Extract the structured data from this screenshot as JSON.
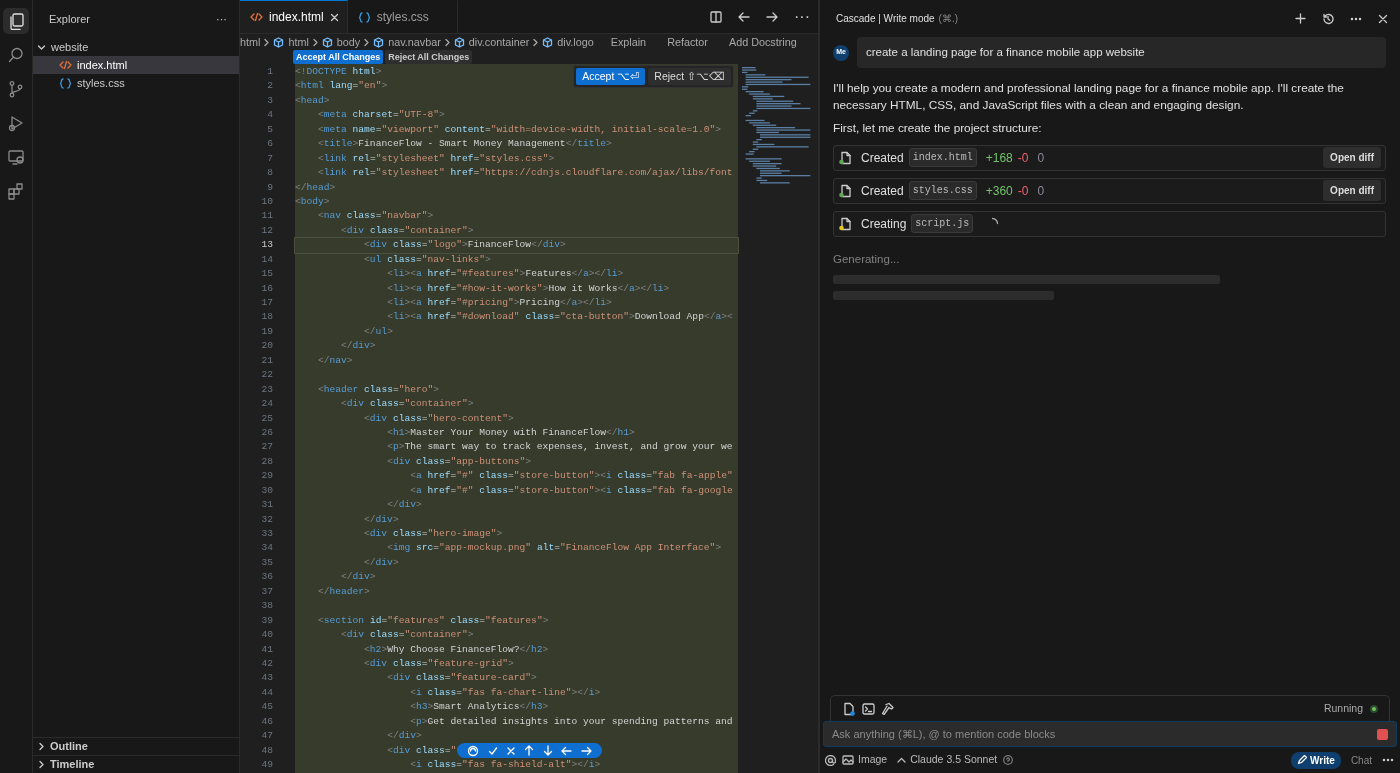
{
  "activity_bar": {
    "items": [
      {
        "kind": "files",
        "selected": true
      },
      {
        "kind": "search",
        "selected": false
      },
      {
        "kind": "branch",
        "selected": false
      },
      {
        "kind": "run",
        "selected": false
      },
      {
        "kind": "monitor",
        "selected": false
      },
      {
        "kind": "blocks",
        "selected": false
      }
    ]
  },
  "sidebar": {
    "title": "Explorer",
    "more": "···",
    "tree": [
      {
        "label": "website",
        "expanded": true,
        "children": [
          {
            "label": "index.html",
            "kind": "html",
            "selected": true
          },
          {
            "label": "styles.css",
            "kind": "css",
            "selected": false
          }
        ]
      }
    ],
    "sections": [
      {
        "label": "Outline",
        "expanded": false
      },
      {
        "label": "Timeline",
        "expanded": false
      }
    ]
  },
  "editor": {
    "tabs": [
      {
        "label": "index.html",
        "kind": "html",
        "selected": true
      },
      {
        "label": "styles.css",
        "kind": "css",
        "selected": false
      }
    ],
    "more": "···",
    "breadcrumbs": [
      {
        "label": "html",
        "kind": "folder"
      },
      {
        "label": "html",
        "kind": "element"
      },
      {
        "label": "body",
        "kind": "element"
      },
      {
        "label": "nav.navbar",
        "kind": "element"
      },
      {
        "label": "div.container",
        "kind": "element"
      },
      {
        "label": "div.logo",
        "kind": "element"
      }
    ],
    "code_actions": [
      "Explain",
      "Refactor",
      "Add Docstring"
    ],
    "accept_all": "Accept All Changes",
    "reject_all": "Reject All Changes",
    "accept": {
      "label": "Accept",
      "shortcut": "⌥⏎"
    },
    "reject": {
      "label": "Reject",
      "shortcut": "⇧⌥⌫"
    },
    "lines": [
      {
        "num": "1",
        "text": "<!DOCTYPE html>",
        "current": false
      },
      {
        "num": "2",
        "text": "<html lang=\"en\">",
        "current": false
      },
      {
        "num": "3",
        "text": "<head>",
        "current": false
      },
      {
        "num": "4",
        "text": "    <meta charset=\"UTF-8\">",
        "current": false
      },
      {
        "num": "5",
        "text": "    <meta name=\"viewport\" content=\"width=device-width, initial-scale=1.0\">",
        "current": false
      },
      {
        "num": "6",
        "text": "    <title>FinanceFlow - Smart Money Management</title>",
        "current": false
      },
      {
        "num": "7",
        "text": "    <link rel=\"stylesheet\" href=\"styles.css\">",
        "current": false
      },
      {
        "num": "8",
        "text": "    <link rel=\"stylesheet\" href=\"https://cdnjs.cloudflare.com/ajax/libs/font",
        "current": false
      },
      {
        "num": "9",
        "text": "</head>",
        "current": false
      },
      {
        "num": "10",
        "text": "<body>",
        "current": false
      },
      {
        "num": "11",
        "text": "    <nav class=\"navbar\">",
        "current": false
      },
      {
        "num": "12",
        "text": "        <div class=\"container\">",
        "current": false
      },
      {
        "num": "13",
        "text": "            <div class=\"logo\">FinanceFlow</div>",
        "current": true
      },
      {
        "num": "14",
        "text": "            <ul class=\"nav-links\">",
        "current": false
      },
      {
        "num": "15",
        "text": "                <li><a href=\"#features\">Features</a></li>",
        "current": false
      },
      {
        "num": "16",
        "text": "                <li><a href=\"#how-it-works\">How it Works</a></li>",
        "current": false
      },
      {
        "num": "17",
        "text": "                <li><a href=\"#pricing\">Pricing</a></li>",
        "current": false
      },
      {
        "num": "18",
        "text": "                <li><a href=\"#download\" class=\"cta-button\">Download App</a><",
        "current": false
      },
      {
        "num": "19",
        "text": "            </ul>",
        "current": false
      },
      {
        "num": "20",
        "text": "        </div>",
        "current": false
      },
      {
        "num": "21",
        "text": "    </nav>",
        "current": false
      },
      {
        "num": "22",
        "current": false
      },
      {
        "num": "23",
        "text": "    <header class=\"hero\">",
        "current": false
      },
      {
        "num": "24",
        "text": "        <div class=\"container\">",
        "current": false
      },
      {
        "num": "25",
        "text": "            <div class=\"hero-content\">",
        "current": false
      },
      {
        "num": "26",
        "text": "                <h1>Master Your Money with FinanceFlow</h1>",
        "current": false
      },
      {
        "num": "27",
        "text": "                <p>The smart way to track expenses, invest, and grow your we",
        "current": false
      },
      {
        "num": "28",
        "text": "                <div class=\"app-buttons\">",
        "current": false
      },
      {
        "num": "29",
        "text": "                    <a href=\"#\" class=\"store-button\"><i class=\"fab fa-apple\"",
        "current": false
      },
      {
        "num": "30",
        "text": "                    <a href=\"#\" class=\"store-button\"><i class=\"fab fa-google",
        "current": false
      },
      {
        "num": "31",
        "text": "                </div>",
        "current": false
      },
      {
        "num": "32",
        "text": "            </div>",
        "current": false
      },
      {
        "num": "33",
        "text": "            <div class=\"hero-image\">",
        "current": false
      },
      {
        "num": "34",
        "text": "                <img src=\"app-mockup.png\" alt=\"FinanceFlow App Interface\">",
        "current": false
      },
      {
        "num": "35",
        "text": "            </div>",
        "current": false
      },
      {
        "num": "36",
        "text": "        </div>",
        "current": false
      },
      {
        "num": "37",
        "text": "    </header>",
        "current": false
      },
      {
        "num": "38",
        "current": false
      },
      {
        "num": "39",
        "text": "    <section id=\"features\" class=\"features\">",
        "current": false
      },
      {
        "num": "40",
        "text": "        <div class=\"container\">",
        "current": false
      },
      {
        "num": "41",
        "text": "            <h2>Why Choose FinanceFlow?</h2>",
        "current": false
      },
      {
        "num": "42",
        "text": "            <div class=\"feature-grid\">",
        "current": false
      },
      {
        "num": "43",
        "text": "                <div class=\"feature-card\">",
        "current": false
      },
      {
        "num": "44",
        "text": "                    <i class=\"fas fa-chart-line\"></i>",
        "current": false
      },
      {
        "num": "45",
        "text": "                    <h3>Smart Analytics</h3>",
        "current": false
      },
      {
        "num": "46",
        "text": "                    <p>Get detailed insights into your spending patterns and",
        "current": false
      },
      {
        "num": "47",
        "text": "                </div>",
        "current": false
      },
      {
        "num": "48",
        "text": "                <div class=\"",
        "current": false
      },
      {
        "num": "49",
        "text": "                    <i class=\"fas fa-shield-alt\"></i>",
        "current": false
      }
    ]
  },
  "chat": {
    "title": "Cascade | Write mode",
    "shortcut": "(⌘.)",
    "user": {
      "avatar": "Me",
      "message": "create a landing page for a finance mobile app website"
    },
    "paragraphs": [
      "I'll help you create a modern and professional landing page for a finance mobile app. I'll create the necessary HTML, CSS, and JavaScript files with a clean and engaging design.",
      "First, let me create the project structure:"
    ],
    "steps": [
      {
        "kind": "done",
        "label": "Created",
        "file": "index.html",
        "added": "+168",
        "removed": "-0",
        "unchanged": "0",
        "action": "Open diff",
        "color": "#5fa954"
      },
      {
        "kind": "done",
        "label": "Created",
        "file": "styles.css",
        "added": "+360",
        "removed": "-0",
        "unchanged": "0",
        "action": "Open diff",
        "color": "#5fa954"
      },
      {
        "kind": "pending",
        "label": "Creating",
        "file": "script.js",
        "color": "#e6c619"
      }
    ],
    "status": "Generating...",
    "running": "Running",
    "input": {
      "placeholder": "Ask anything (⌘L), @ to mention code blocks"
    },
    "footer": {
      "image": "Image",
      "model": "Claude 3.5 Sonnet",
      "modes": [
        {
          "label": "Write",
          "selected": true
        },
        {
          "label": "Chat",
          "selected": false
        }
      ]
    }
  }
}
